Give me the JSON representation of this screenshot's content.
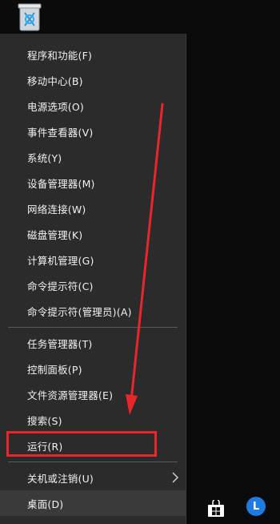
{
  "menu": {
    "items": [
      {
        "label": "程序和功能(F)"
      },
      {
        "label": "移动中心(B)"
      },
      {
        "label": "电源选项(O)"
      },
      {
        "label": "事件查看器(V)"
      },
      {
        "label": "系统(Y)"
      },
      {
        "label": "设备管理器(M)"
      },
      {
        "label": "网络连接(W)"
      },
      {
        "label": "磁盘管理(K)"
      },
      {
        "label": "计算机管理(G)"
      },
      {
        "label": "命令提示符(C)"
      },
      {
        "label": "命令提示符(管理员)(A)"
      },
      {
        "label": "任务管理器(T)"
      },
      {
        "label": "控制面板(P)"
      },
      {
        "label": "文件资源管理器(E)"
      },
      {
        "label": "搜索(S)"
      },
      {
        "label": "运行(R)"
      },
      {
        "label": "关机或注销(U)"
      },
      {
        "label": "桌面(D)"
      }
    ]
  },
  "taskbar": {
    "avatar_letter": "L"
  },
  "colors": {
    "menu_bg": "#2b2b2b",
    "highlight_red": "#e8262b",
    "avatar_blue": "#1f7be0"
  },
  "icons": [
    "recycle-bin-icon",
    "chevron-right-icon",
    "windows-store-icon"
  ]
}
